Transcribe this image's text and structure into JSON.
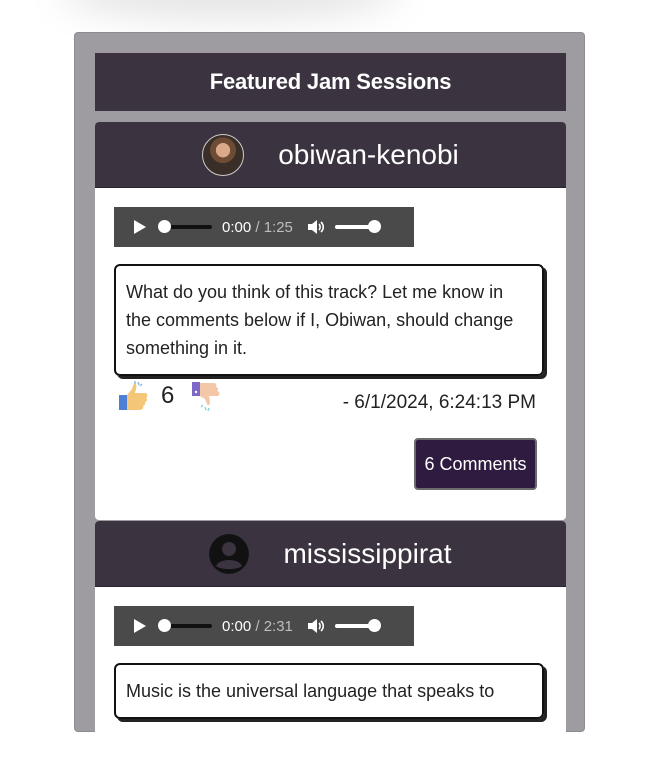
{
  "panel": {
    "title": "Featured Jam Sessions"
  },
  "posts": [
    {
      "username": "obiwan-kenobi",
      "audio": {
        "current": "0:00",
        "duration": "/ 1:25"
      },
      "comment": "What do you think of this track? Let me know in the comments below if I, Obiwan, should change something in it.",
      "likes": "6",
      "date": "- 6/1/2024, 6:24:13 PM",
      "comments_button": "6 Comments"
    },
    {
      "username": "mississippirat",
      "audio": {
        "current": "0:00",
        "duration": "/ 2:31"
      },
      "comment": "Music is the universal language that speaks to"
    }
  ]
}
